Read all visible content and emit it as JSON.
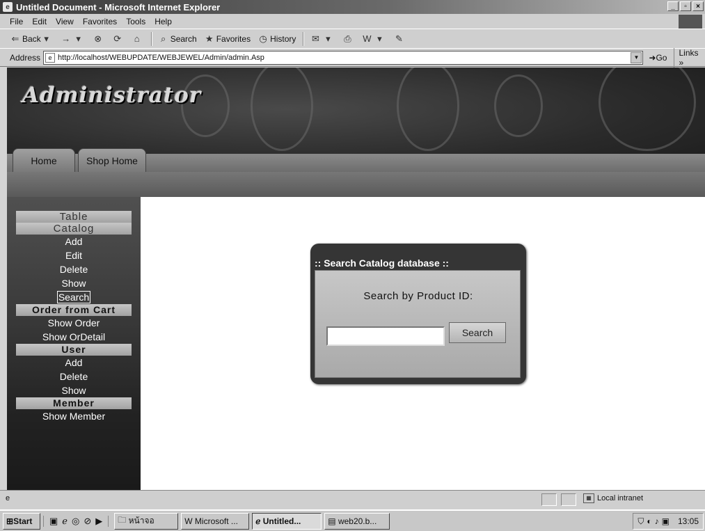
{
  "window": {
    "title": "Untitled Document - Microsoft Internet Explorer",
    "buttons": [
      "_",
      "▫",
      "×"
    ]
  },
  "menu": [
    "File",
    "Edit",
    "View",
    "Favorites",
    "Tools",
    "Help"
  ],
  "toolbar": {
    "back": "Back",
    "search": "Search",
    "favorites": "Favorites",
    "history": "History"
  },
  "address": {
    "label": "Address",
    "url": "http://localhost/WEBUPDATE/WEBJEWEL/Admin/admin.Asp",
    "go": "Go",
    "links": "Links »"
  },
  "banner": {
    "title": "Administrator",
    "tabs": [
      "Home",
      "Shop Home"
    ]
  },
  "sidebar": {
    "table_header": "Table",
    "catalog_header": "Catalog",
    "catalog_items": [
      "Add",
      "Edit",
      "Delete",
      "Show",
      "Search"
    ],
    "order_header": "Order from Cart",
    "order_items": [
      "Show Order",
      "Show OrDetail"
    ],
    "user_header": "User",
    "user_items": [
      "Add",
      "Delete",
      "Show"
    ],
    "member_header": "Member",
    "member_items": [
      "Show Member"
    ]
  },
  "panel": {
    "title": ":: Search Catalog database ::",
    "label": "Search by Product ID:",
    "input_value": "",
    "button": "Search"
  },
  "status": {
    "zone": "Local intranet"
  },
  "taskbar": {
    "start": "Start",
    "tasks": [
      "หน้าจอ",
      "Microsoft ...",
      "Untitled...",
      "web20.b..."
    ],
    "clock": "13:05"
  }
}
